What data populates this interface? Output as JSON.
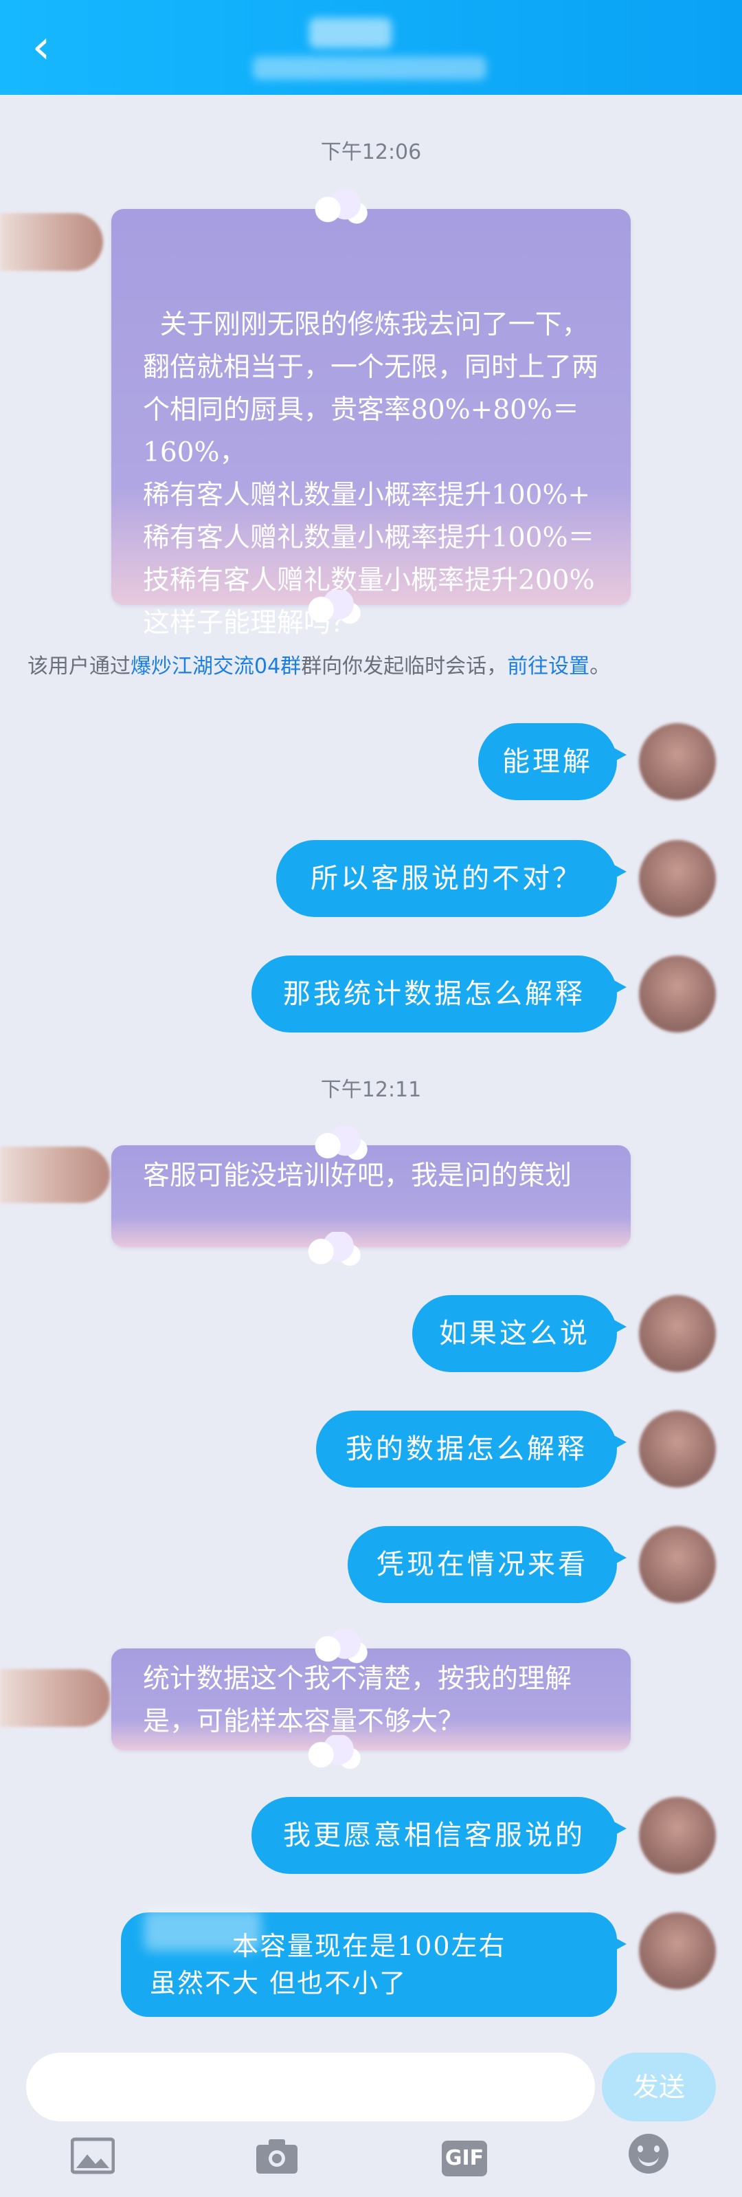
{
  "header": {
    "back_glyph": "‹"
  },
  "timestamps": [
    "下午12:06",
    "下午12:11"
  ],
  "messages": [
    {
      "side": "left",
      "text": "关于刚刚无限的修炼我去问了一下，翻倍就相当于，一个无限，同时上了两个相同的厨具，贵客率80%+80%＝160%，\n稀有客人赠礼数量小概率提升100%+ 稀有客人赠礼数量小概率提升100%＝技稀有客人赠礼数量小概率提升200%\n这样子能理解吗？"
    },
    {
      "side": "right",
      "text": "能理解"
    },
    {
      "side": "right",
      "text": "所以客服说的不对？"
    },
    {
      "side": "right",
      "text": "那我统计数据怎么解释"
    },
    {
      "side": "left",
      "text": "客服可能没培训好吧，我是问的策划"
    },
    {
      "side": "right",
      "text": "如果这么说"
    },
    {
      "side": "right",
      "text": "我的数据怎么解释"
    },
    {
      "side": "right",
      "text": "凭现在情况来看"
    },
    {
      "side": "left",
      "text": "统计数据这个我不清楚，按我的理解是，可能样本容量不够大？"
    },
    {
      "side": "right",
      "text": "我更愿意相信客服说的"
    },
    {
      "side": "right",
      "line1": "本容量现在是100左右",
      "line2": "虽然不大 但也不小了"
    }
  ],
  "notice": {
    "prefix": "该用户通过",
    "group_link": "爆炒江湖交流04群",
    "middle": "群向你发起临时会话，",
    "settings_link": "前往设置",
    "suffix": "。"
  },
  "input": {
    "send_label": "发送"
  },
  "toolbar": {
    "image_icon": "image-icon",
    "camera_icon": "camera-icon",
    "gif_label": "GIF",
    "emoji_icon": "emoji-icon"
  },
  "colors": {
    "header": "#0aa2f5",
    "bubble_right": "#17aaf2",
    "bubble_left": "#a69ee0",
    "link": "#1a7fe0",
    "send_disabled": "#b4e4fb"
  }
}
